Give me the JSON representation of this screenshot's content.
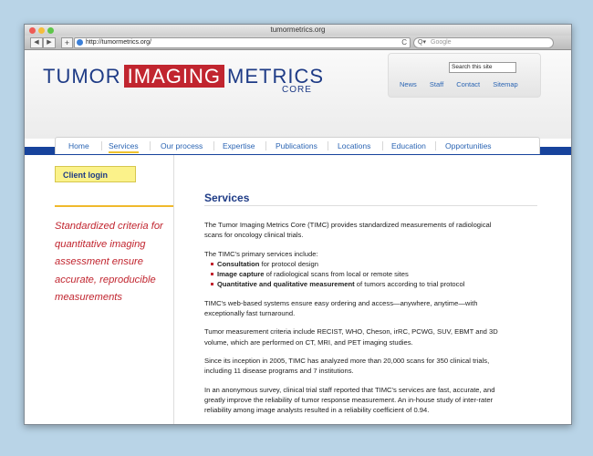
{
  "browser": {
    "title": "tumormetrics.org",
    "url": "http://tumormetrics.org/",
    "search_placeholder": "Google",
    "back_glyph": "◀",
    "forward_glyph": "▶",
    "add_glyph": "+",
    "reload_glyph": "C",
    "search_glyph": "Q▾"
  },
  "logo": {
    "word1": "TUMOR",
    "word2": "IMAGING",
    "word3": "METRICS",
    "sub": "CORE"
  },
  "util": {
    "search_placeholder": "Search this site",
    "links": [
      "News",
      "Staff",
      "Contact",
      "Sitemap"
    ]
  },
  "nav": {
    "items": [
      "Home",
      "Services",
      "Our process",
      "Expertise",
      "Publications",
      "Locations",
      "Education",
      "Opportunities"
    ],
    "active": "Services"
  },
  "sidebar": {
    "login_label": "Client login",
    "tagline": "Standardized criteria for quantitative imaging assessment ensure accurate, reproducible measurements"
  },
  "content": {
    "heading": "Services",
    "intro": "The Tumor Imaging Metrics Core (TIMC) provides standardized measurements of radiological scans for oncology clinical trials.",
    "services_lead": "The TIMC's primary services include:",
    "services": [
      {
        "bold": "Consultation",
        "rest": " for protocol design"
      },
      {
        "bold": "Image capture",
        "rest": " of radiological scans from local or remote sites"
      },
      {
        "bold": "Quantitative and qualitative measurement",
        "rest": " of tumors according to trial protocol"
      }
    ],
    "p2": "TIMC's web-based systems ensure easy ordering and access—anywhere, anytime—with exceptionally fast turnaround.",
    "p3": "Tumor measurement criteria include RECIST, WHO, Cheson, irRC, PCWG, SUV, EBMT and 3D volume, which are performed on CT, MRI, and PET imaging studies.",
    "p4": "Since its inception in 2005, TIMC has analyzed more than 20,000 scans for 350 clinical trials, including 11 disease programs and 7 institutions.",
    "p5": "In an anonymous survey, clinical trial staff reported that TIMC's services are fast, accurate, and greatly improve the reliability of tumor response measurement. An in-house study of inter-rater reliability among image analysts resulted in a reliability coefficient of 0.94."
  }
}
